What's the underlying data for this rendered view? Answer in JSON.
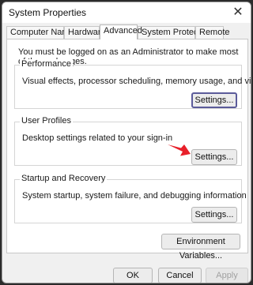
{
  "window": {
    "title": "System Properties",
    "close_glyph": "✕"
  },
  "tabs": [
    {
      "label": "Computer Name"
    },
    {
      "label": "Hardware"
    },
    {
      "label": "Advanced"
    },
    {
      "label": "System Protection"
    },
    {
      "label": "Remote"
    }
  ],
  "active_tab": "Advanced",
  "notice": "You must be logged on as an Administrator to make most of these changes.",
  "groups": {
    "performance": {
      "title": "Performance",
      "description": "Visual effects, processor scheduling, memory usage, and virtual memory",
      "button": "Settings..."
    },
    "user_profiles": {
      "title": "User Profiles",
      "description": "Desktop settings related to your sign-in",
      "button": "Settings..."
    },
    "startup_recovery": {
      "title": "Startup and Recovery",
      "description": "System startup, system failure, and debugging information",
      "button": "Settings..."
    }
  },
  "env_button": "Environment Variables...",
  "footer": {
    "ok": "OK",
    "cancel": "Cancel",
    "apply": "Apply"
  },
  "colors": {
    "accent_arrow": "#e8202a",
    "focus_border": "#5b5b9a"
  },
  "icons": {
    "close": "close-icon",
    "pointer": "red-arrow-pointer-icon"
  }
}
